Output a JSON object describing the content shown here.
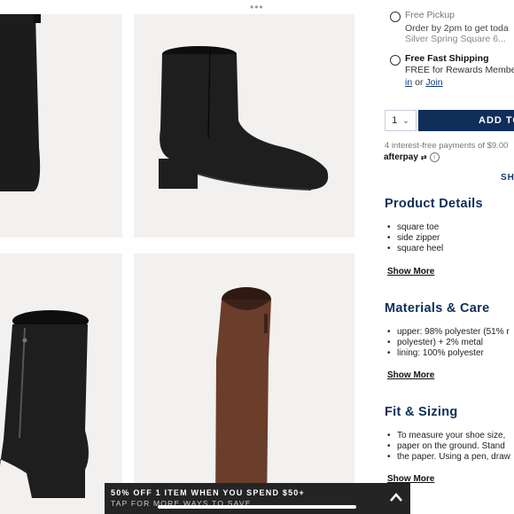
{
  "product": {
    "images": [
      {
        "alt": "black suede boot side view (cropped)"
      },
      {
        "alt": "black suede block-heel ankle boot"
      },
      {
        "alt": "black suede boot back zipper view"
      },
      {
        "alt": "brown suede ankle boot"
      }
    ],
    "colors": {
      "black_suede": "#1c1c1c",
      "brown_suede": "#6b3d2b",
      "tile_bg": "#f2f1ef"
    }
  },
  "fulfillment": {
    "pickup": {
      "title": "Free Pickup",
      "line1": "Order by 2pm to get toda",
      "line2": "Silver Spring Square 6..."
    },
    "shipping": {
      "title": "Free Fast Shipping",
      "line1": "FREE for Rewards Member",
      "link_sign_in": "in",
      "or_text": " or ",
      "link_join": "Join"
    }
  },
  "purchase": {
    "quantity": "1",
    "add_label": "ADD TO",
    "afterpay_text": "4 interest-free payments of $9.00",
    "afterpay_brand": "afterpay",
    "ship_link": "SHI"
  },
  "sections": {
    "details": {
      "title": "Product Details",
      "items": [
        "square toe",
        "side zipper",
        "square heel"
      ],
      "show_more": "Show More"
    },
    "materials": {
      "title": "Materials & Care",
      "items": [
        "upper: 98% polyester (51% r",
        "polyester) + 2% metal",
        "lining: 100% polyester"
      ],
      "show_more": "Show More"
    },
    "sizing": {
      "title": "Fit & Sizing",
      "items": [
        "To measure your shoe size,",
        "paper on the ground. Stand",
        "the paper. Using a pen, draw"
      ],
      "show_more": "Show More"
    }
  },
  "promo": {
    "line1": "50% OFF 1 ITEM WHEN YOU SPEND $50+",
    "line2": "TAP FOR MORE WAYS TO SAVE"
  }
}
